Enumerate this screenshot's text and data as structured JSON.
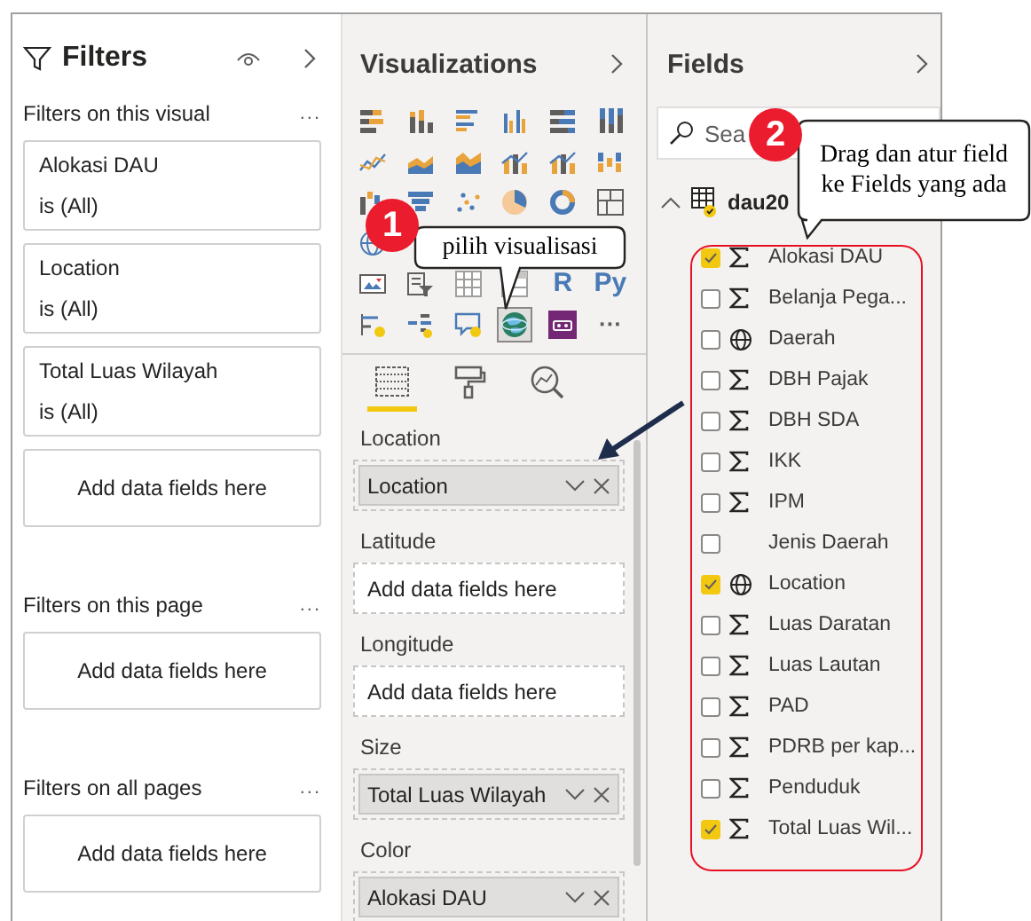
{
  "filters_pane": {
    "title": "Filters",
    "sections": [
      {
        "title": "Filters on this visual",
        "more": "...",
        "cards": [
          {
            "kind": "filter",
            "name": "Alokasi DAU",
            "condition": "is (All)"
          },
          {
            "kind": "filter",
            "name": "Location",
            "condition": "is (All)"
          },
          {
            "kind": "filter",
            "name": "Total Luas Wilayah",
            "condition": "is (All)"
          },
          {
            "kind": "drop",
            "text": "Add data fields here"
          }
        ]
      },
      {
        "title": "Filters on this page",
        "more": "...",
        "cards": [
          {
            "kind": "drop",
            "text": "Add data fields here"
          }
        ]
      },
      {
        "title": "Filters on all pages",
        "more": "...",
        "cards": [
          {
            "kind": "drop",
            "text": "Add data fields here"
          }
        ]
      }
    ]
  },
  "visualizations_pane": {
    "title": "Visualizations",
    "icon_rows": [
      [
        {
          "kind": "stacked-bar",
          "selected": false
        },
        {
          "kind": "stacked-column",
          "selected": false
        },
        {
          "kind": "clustered-bar",
          "selected": false
        },
        {
          "kind": "clustered-column",
          "selected": false
        },
        {
          "kind": "bar-100",
          "selected": false
        },
        {
          "kind": "column-100",
          "selected": false
        }
      ],
      [
        {
          "kind": "line",
          "selected": false
        },
        {
          "kind": "area",
          "selected": false
        },
        {
          "kind": "stacked-area",
          "selected": false
        },
        {
          "kind": "line-column",
          "selected": false
        },
        {
          "kind": "line-column",
          "selected": false
        },
        {
          "kind": "ribbon",
          "selected": false
        }
      ],
      [
        {
          "kind": "waterfall",
          "selected": false
        },
        {
          "kind": "funnel",
          "selected": false
        },
        {
          "kind": "scatter",
          "selected": false
        },
        {
          "kind": "pie",
          "selected": false
        },
        {
          "kind": "donut",
          "selected": false
        },
        {
          "kind": "treemap",
          "selected": false
        }
      ],
      [
        {
          "kind": "map",
          "selected": false
        }
      ],
      [
        {
          "kind": "kpi",
          "selected": false
        },
        {
          "kind": "slicer",
          "selected": false
        },
        {
          "kind": "table",
          "selected": false
        },
        {
          "kind": "matrix",
          "selected": false
        },
        {
          "kind": "label",
          "label": "R",
          "selected": false
        },
        {
          "kind": "label",
          "label": "Py",
          "selected": false
        }
      ],
      [
        {
          "kind": "influencers",
          "selected": false
        },
        {
          "kind": "decomposition",
          "selected": false
        },
        {
          "kind": "qna",
          "selected": false
        },
        {
          "kind": "globe",
          "selected": true
        },
        {
          "kind": "power-apps",
          "selected": false
        },
        {
          "kind": "label",
          "label": "···",
          "selected": false
        }
      ]
    ],
    "tabs": [
      {
        "kind": "fields",
        "selected": true
      },
      {
        "kind": "format",
        "selected": false
      },
      {
        "kind": "analytics",
        "selected": false
      }
    ],
    "wells": [
      {
        "label": "Location",
        "value": "Location"
      },
      {
        "label": "Latitude",
        "placeholder": "Add data fields here"
      },
      {
        "label": "Longitude",
        "placeholder": "Add data fields here"
      },
      {
        "label": "Size",
        "value": "Total Luas Wilayah"
      },
      {
        "label": "Color",
        "value": "Alokasi DAU"
      }
    ]
  },
  "fields_pane": {
    "title": "Fields",
    "search": {
      "placeholder": "Sea"
    },
    "table": {
      "name": "dau20",
      "expanded": true,
      "fields": [
        {
          "name": "Alokasi DAU",
          "kind": "measure",
          "checked": true
        },
        {
          "name": "Belanja Pega...",
          "kind": "measure",
          "checked": false
        },
        {
          "name": "Daerah",
          "kind": "geo",
          "checked": false
        },
        {
          "name": "DBH Pajak",
          "kind": "measure",
          "checked": false
        },
        {
          "name": "DBH SDA",
          "kind": "measure",
          "checked": false
        },
        {
          "name": "IKK",
          "kind": "measure",
          "checked": false
        },
        {
          "name": "IPM",
          "kind": "measure",
          "checked": false
        },
        {
          "name": "Jenis Daerah",
          "kind": "text",
          "checked": false
        },
        {
          "name": "Location",
          "kind": "geo",
          "checked": true
        },
        {
          "name": "Luas Daratan",
          "kind": "measure",
          "checked": false
        },
        {
          "name": "Luas Lautan",
          "kind": "measure",
          "checked": false
        },
        {
          "name": "PAD",
          "kind": "measure",
          "checked": false
        },
        {
          "name": "PDRB per kap...",
          "kind": "measure",
          "checked": false
        },
        {
          "name": "Penduduk",
          "kind": "measure",
          "checked": false
        },
        {
          "name": "Total Luas Wil...",
          "kind": "measure",
          "checked": true
        }
      ]
    }
  },
  "callouts": [
    {
      "number": "1",
      "text": "pilih visualisasi"
    },
    {
      "number": "2",
      "text": "Drag dan atur field ke Fields yang ada"
    }
  ]
}
